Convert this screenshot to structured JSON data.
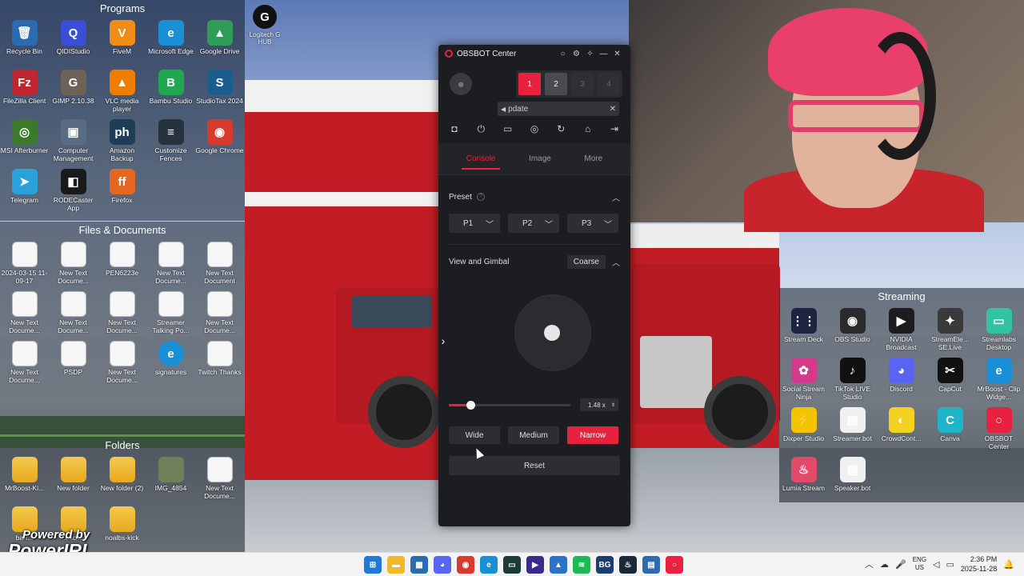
{
  "desktop": {
    "programs": {
      "title": "Programs",
      "icons": [
        {
          "label": "Recycle Bin",
          "icon": "recycle-bin-icon",
          "color": "#2b6cb0",
          "glyph": "🗑"
        },
        {
          "label": "QIDIStudio",
          "icon": "qidistudio-icon",
          "color": "#3b4fd6",
          "glyph": "Q"
        },
        {
          "label": "FiveM",
          "icon": "fivem-icon",
          "color": "#f28c18",
          "glyph": "V"
        },
        {
          "label": "Microsoft Edge",
          "icon": "edge-icon",
          "color": "#1a8fd6",
          "glyph": "e"
        },
        {
          "label": "Google Drive",
          "icon": "google-drive-icon",
          "color": "#2f9d58",
          "glyph": "▲"
        },
        {
          "label": "FileZilla Client",
          "icon": "filezilla-icon",
          "color": "#c0262d",
          "glyph": "Fz"
        },
        {
          "label": "GIMP 2.10.38",
          "icon": "gimp-icon",
          "color": "#6e6256",
          "glyph": "G"
        },
        {
          "label": "VLC media player",
          "icon": "vlc-icon",
          "color": "#ef7d00",
          "glyph": "▲"
        },
        {
          "label": "Bambu Studio",
          "icon": "bambu-studio-icon",
          "color": "#1fa84f",
          "glyph": "B"
        },
        {
          "label": "StudioTax 2024",
          "icon": "studiotax-icon",
          "color": "#1a5e8f",
          "glyph": "S"
        },
        {
          "label": "MSI Afterburner",
          "icon": "msi-afterburner-icon",
          "color": "#3a7a2a",
          "glyph": "◎"
        },
        {
          "label": "Computer Management",
          "icon": "computer-management-icon",
          "color": "#5a6c84",
          "glyph": "▣"
        },
        {
          "label": "Amazon Backup",
          "icon": "amazon-photos-icon",
          "color": "#1f3d57",
          "glyph": "ph"
        },
        {
          "label": "Customize Fences",
          "icon": "fences-icon",
          "color": "#26323e",
          "glyph": "≡"
        },
        {
          "label": "Google Chrome",
          "icon": "chrome-icon",
          "color": "#d93a2e",
          "glyph": "◉"
        },
        {
          "label": "Telegram",
          "icon": "telegram-icon",
          "color": "#2aa1da",
          "glyph": "➤"
        },
        {
          "label": "RODECaster App",
          "icon": "rodecaster-icon",
          "color": "#1a1a1a",
          "glyph": "◧"
        },
        {
          "label": "Firefox",
          "icon": "firefox-icon",
          "color": "#e5661f",
          "glyph": "ff"
        }
      ]
    },
    "files": {
      "title": "Files & Documents",
      "icons": [
        {
          "label": "2024-03-15 11-09-17",
          "icon": "document-icon"
        },
        {
          "label": "New Text Docume...",
          "icon": "text-document-icon"
        },
        {
          "label": "PEN6223e",
          "icon": "chrome-html-icon"
        },
        {
          "label": "New Text Docume...",
          "icon": "text-document-icon"
        },
        {
          "label": "New Text Document",
          "icon": "text-document-icon"
        },
        {
          "label": "New Text Docume...",
          "icon": "text-document-icon"
        },
        {
          "label": "New Text Docume...",
          "icon": "text-document-icon"
        },
        {
          "label": "New Text Docume...",
          "icon": "text-document-icon"
        },
        {
          "label": "Streamer Talking Po...",
          "icon": "text-document-icon"
        },
        {
          "label": "New Text Docume...",
          "icon": "text-document-icon"
        },
        {
          "label": "New Text Docume...",
          "icon": "text-document-icon"
        },
        {
          "label": "PSDP",
          "icon": "text-document-icon"
        },
        {
          "label": "New Text Docume...",
          "icon": "text-document-icon"
        },
        {
          "label": "signatures",
          "icon": "edge-html-icon"
        },
        {
          "label": "Twitch Thanks",
          "icon": "text-document-icon"
        }
      ]
    },
    "folders": {
      "title": "Folders",
      "icons": [
        {
          "label": "MrBoost-Ki...",
          "icon": "folder-icon"
        },
        {
          "label": "New folder",
          "icon": "folder-icon"
        },
        {
          "label": "New folder (2)",
          "icon": "folder-icon"
        },
        {
          "label": "IMG_4854",
          "icon": "image-icon"
        },
        {
          "label": "New Text Docume...",
          "icon": "text-document-icon"
        },
        {
          "label": "barr...",
          "icon": "folder-icon"
        },
        {
          "label": "...backup",
          "icon": "folder-icon"
        },
        {
          "label": "noalbs-kick",
          "icon": "folder-icon"
        }
      ]
    },
    "logitech": {
      "label": "Logitech G HUB",
      "icon": "logitech-ghub-icon"
    },
    "streaming": {
      "title": "Streaming",
      "icons": [
        {
          "label": "Stream Deck",
          "icon": "stream-deck-icon",
          "color": "#1c2440",
          "glyph": "⋮⋮"
        },
        {
          "label": "OBS Studio",
          "icon": "obs-studio-icon",
          "color": "#2a2a2a",
          "glyph": "◉"
        },
        {
          "label": "NVIDIA Broadcast",
          "icon": "nvidia-broadcast-icon",
          "color": "#1d1d1d",
          "glyph": "▶"
        },
        {
          "label": "StreamEle... SE.Live",
          "icon": "streamelements-icon",
          "color": "#3a3a3a",
          "glyph": "✦"
        },
        {
          "label": "Streamlabs Desktop",
          "icon": "streamlabs-icon",
          "color": "#31c3a2",
          "glyph": "▭"
        },
        {
          "label": "Social Stream Ninja",
          "icon": "social-stream-ninja-icon",
          "color": "#d43a8c",
          "glyph": "✿"
        },
        {
          "label": "TikTok LIVE Studio",
          "icon": "tiktok-live-icon",
          "color": "#111111",
          "glyph": "♪"
        },
        {
          "label": "Discord",
          "icon": "discord-icon",
          "color": "#5865f2",
          "glyph": "◕"
        },
        {
          "label": "CapCut",
          "icon": "capcut-icon",
          "color": "#111111",
          "glyph": "✂"
        },
        {
          "label": "MrBoost - Clip Widge...",
          "icon": "edge-icon",
          "color": "#1a8fd6",
          "glyph": "e"
        },
        {
          "label": "Dixper Studio",
          "icon": "dixper-icon",
          "color": "#f5c400",
          "glyph": "⚡"
        },
        {
          "label": "Streamer.bot",
          "icon": "streamerbot-icon",
          "color": "#f0f0f0",
          "glyph": "▤"
        },
        {
          "label": "CrowdCont...",
          "icon": "crowdcontrol-icon",
          "color": "#f4d21f",
          "glyph": "◐"
        },
        {
          "label": "Canva",
          "icon": "canva-icon",
          "color": "#1fb5c8",
          "glyph": "C"
        },
        {
          "label": "OBSBOT Center",
          "icon": "obsbot-center-icon",
          "color": "#e8213e",
          "glyph": "○"
        },
        {
          "label": "Lumia Stream",
          "icon": "lumia-stream-icon",
          "color": "#e24a6a",
          "glyph": "♨"
        },
        {
          "label": "Speaker.bot",
          "icon": "speakerbot-icon",
          "color": "#f0f0f0",
          "glyph": "▤"
        }
      ]
    }
  },
  "obsbot": {
    "title": "OBSBOT Center",
    "cameras": [
      "1",
      "2",
      "3",
      "4"
    ],
    "update_text": "pdate",
    "tabs": [
      "Console",
      "Image",
      "More"
    ],
    "preset": {
      "title": "Preset",
      "options": [
        "P1",
        "P2",
        "P3"
      ]
    },
    "gimbal": {
      "title": "View and Gimbal",
      "mode": "Coarse"
    },
    "zoom": {
      "value": "1.48 x",
      "level": 0.18
    },
    "fov": [
      "Wide",
      "Medium",
      "Narrow"
    ],
    "fov_selected": "Narrow",
    "reset_label": "Reset"
  },
  "taskbar": {
    "icons": [
      {
        "name": "start-icon",
        "color": "#1f7ad6",
        "glyph": "⊞"
      },
      {
        "name": "file-explorer-icon",
        "color": "#f1b92a",
        "glyph": "▬"
      },
      {
        "name": "microsoft-store-icon",
        "color": "#2b6cb0",
        "glyph": "▦"
      },
      {
        "name": "discord-icon",
        "color": "#5865f2",
        "glyph": "◕"
      },
      {
        "name": "chrome-icon",
        "color": "#d93a2e",
        "glyph": "◉"
      },
      {
        "name": "edge-icon",
        "color": "#1a8fd6",
        "glyph": "e"
      },
      {
        "name": "streamlabs-icon",
        "color": "#1d3a37",
        "glyph": "▭"
      },
      {
        "name": "media-player-icon",
        "color": "#3a2a8a",
        "glyph": "▶"
      },
      {
        "name": "photos-icon",
        "color": "#2a73c9",
        "glyph": "▲"
      },
      {
        "name": "spotify-icon",
        "color": "#1db954",
        "glyph": "≋"
      },
      {
        "name": "bg-icon",
        "color": "#1d3c70",
        "glyph": "BG"
      },
      {
        "name": "steam-icon",
        "color": "#1b2838",
        "glyph": "♨"
      },
      {
        "name": "app-badge-icon",
        "color": "#2b6cb0",
        "glyph": "▤"
      },
      {
        "name": "obsbot-taskbar-icon",
        "color": "#e8213e",
        "glyph": "○"
      }
    ],
    "lang_top": "ENG",
    "lang_bottom": "US",
    "time": "2:36 PM",
    "date": "2025-11-28"
  },
  "watermark": {
    "line1": "Powered by",
    "line2": "PowerIRL"
  }
}
